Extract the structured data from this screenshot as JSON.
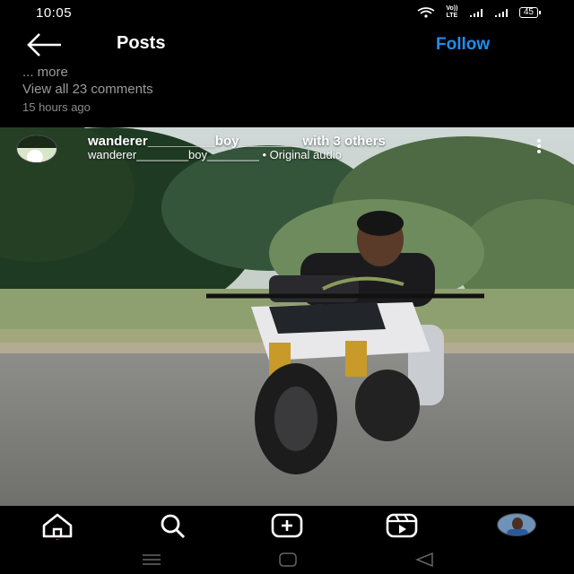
{
  "status_bar": {
    "time": "10:05",
    "volte_top": "Vo)) LTE",
    "battery": "45"
  },
  "header": {
    "title": "Posts",
    "follow_label": "Follow"
  },
  "previous_post": {
    "more_text": "... more",
    "view_comments": "View all 23 comments",
    "time_ago": "15 hours ago"
  },
  "post": {
    "author": "wanderer_________boy________",
    "with_others": "with 3 others",
    "audio_line": "wanderer________boy________ • Original audio"
  },
  "bottom_nav": {
    "items": [
      "home-icon",
      "search-icon",
      "add-post-icon",
      "reels-icon",
      "profile"
    ]
  },
  "colors": {
    "accent": "#1d8ff0",
    "background": "#000000",
    "secondary_text": "#9a9a9a"
  }
}
